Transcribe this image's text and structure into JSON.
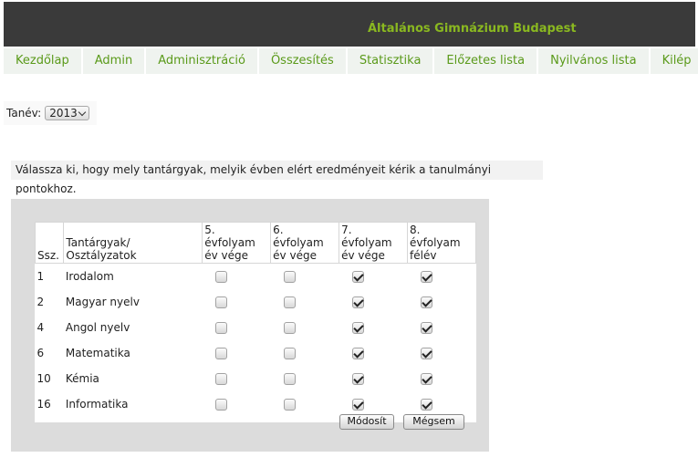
{
  "header": {
    "title": "Általános Gimnázium Budapest"
  },
  "nav": {
    "items": [
      "Kezdőlap",
      "Admin",
      "Adminisztráció",
      "Összesítés",
      "Statisztika",
      "Előzetes lista",
      "Nyilvános lista",
      "Kilép"
    ]
  },
  "year": {
    "label": "Tanév:",
    "selected": "2013"
  },
  "instruction": "Válassza ki, hogy mely tantárgyak, melyik évben elért eredményeit kérik a tanulmányi pontokhoz.",
  "table": {
    "headers": {
      "ssz": "Ssz.",
      "subject": "Tantárgyak/ Osztályzatok",
      "g5": [
        "5. évfolyam",
        "év vége"
      ],
      "g6": [
        "6. évfolyam",
        "év vége"
      ],
      "g7": [
        "7. évfolyam",
        "év vége"
      ],
      "g8": [
        "8. évfolyam",
        "félév"
      ]
    },
    "rows": [
      {
        "num": "1",
        "subject": "Irodalom",
        "checks": [
          false,
          false,
          true,
          true
        ]
      },
      {
        "num": "2",
        "subject": "Magyar nyelv",
        "checks": [
          false,
          false,
          true,
          true
        ]
      },
      {
        "num": "4",
        "subject": "Angol nyelv",
        "checks": [
          false,
          false,
          true,
          true
        ]
      },
      {
        "num": "6",
        "subject": "Matematika",
        "checks": [
          false,
          false,
          true,
          true
        ]
      },
      {
        "num": "10",
        "subject": "Kémia",
        "checks": [
          false,
          false,
          true,
          true
        ]
      },
      {
        "num": "16",
        "subject": "Informatika",
        "checks": [
          false,
          false,
          true,
          true
        ]
      }
    ]
  },
  "buttons": {
    "modify": "Módosít",
    "cancel": "Mégsem"
  }
}
